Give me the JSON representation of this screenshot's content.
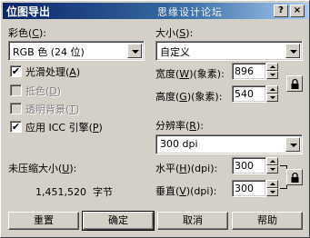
{
  "window": {
    "title": "位图导出",
    "watermark": "思缘设计论坛",
    "help_glyph": "?",
    "close_glyph": "×"
  },
  "color": {
    "label": "彩色",
    "label_key": "C",
    "value": "RGB 色 (24 位)"
  },
  "size": {
    "label": "大小",
    "label_key": "S",
    "value": "自定义"
  },
  "options": [
    {
      "label": "光滑处理",
      "key": "A",
      "checked": true,
      "enabled": true
    },
    {
      "label": "抵色",
      "key": "D",
      "checked": false,
      "enabled": false
    },
    {
      "label": "透明背景",
      "key": "T",
      "checked": false,
      "enabled": false
    },
    {
      "label": "应用 ICC 引擎",
      "key": "P",
      "checked": true,
      "enabled": true
    }
  ],
  "width": {
    "label": "宽度",
    "key": "W",
    "unit": "(象素)",
    "value": "896"
  },
  "height": {
    "label": "高度",
    "key": "G",
    "unit": "(象素)",
    "value": "540"
  },
  "resolution": {
    "label": "分辨率",
    "label_key": "R",
    "value": "300 dpi"
  },
  "horizontal": {
    "label": "水平",
    "key": "H",
    "unit": "(dpi)",
    "value": "300"
  },
  "vertical": {
    "label": "垂直",
    "key": "V",
    "unit": "(dpi)",
    "value": "300"
  },
  "uncompressed": {
    "label": "未压缩大小",
    "label_key": "U",
    "value": "1,451,520",
    "unit": "字节"
  },
  "buttons": {
    "reset": "重置",
    "ok": "确定",
    "cancel": "取消",
    "help": "帮助"
  },
  "check_mark": "✔"
}
